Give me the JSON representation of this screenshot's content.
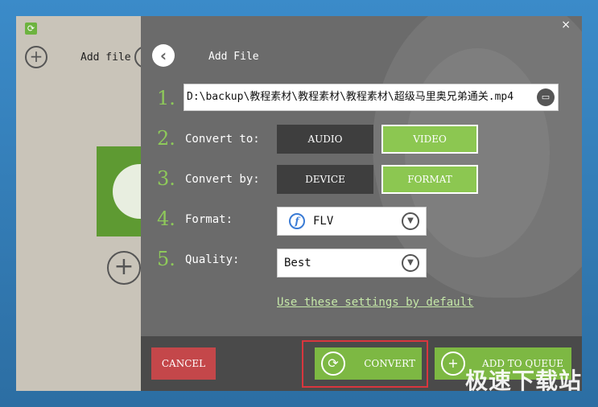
{
  "window": {
    "app_icon": "refresh-icon",
    "close_label": "×"
  },
  "background_app": {
    "add_file_label": "Add file",
    "plus_glyph": "+"
  },
  "dialog": {
    "title": "Add File",
    "back_glyph": "‹",
    "steps": [
      {
        "num": "1.",
        "label": ""
      },
      {
        "num": "2.",
        "label": "Convert to:"
      },
      {
        "num": "3.",
        "label": "Convert by:"
      },
      {
        "num": "4.",
        "label": "Format:"
      },
      {
        "num": "5.",
        "label": "Quality:"
      }
    ],
    "file_path": "D:\\backup\\教程素材\\教程素材\\教程素材\\超级马里奥兄弟通关.mp4",
    "folder_icon": "folder-icon",
    "convert_to": {
      "options": [
        "AUDIO",
        "VIDEO"
      ],
      "selected": "VIDEO"
    },
    "convert_by": {
      "options": [
        "DEVICE",
        "FORMAT"
      ],
      "selected": "FORMAT"
    },
    "format": {
      "value": "FLV",
      "icon": "flash-icon",
      "icon_glyph": "f"
    },
    "quality": {
      "value": "Best"
    },
    "default_link": "Use these settings by default",
    "caret_glyph": "▼"
  },
  "buttons": {
    "cancel": "CANCEL",
    "convert": "CONVERT",
    "add_to_queue": "ADD TO QUEUE",
    "convert_glyph": "⟳",
    "queue_glyph": "+"
  },
  "watermark": "极速下载站",
  "colors": {
    "accent_green": "#8cc751",
    "cancel_red": "#c4474a",
    "highlight_red": "#d9363e",
    "dialog_bg": "#6b6b6b",
    "step_number": "#8ec95a"
  }
}
